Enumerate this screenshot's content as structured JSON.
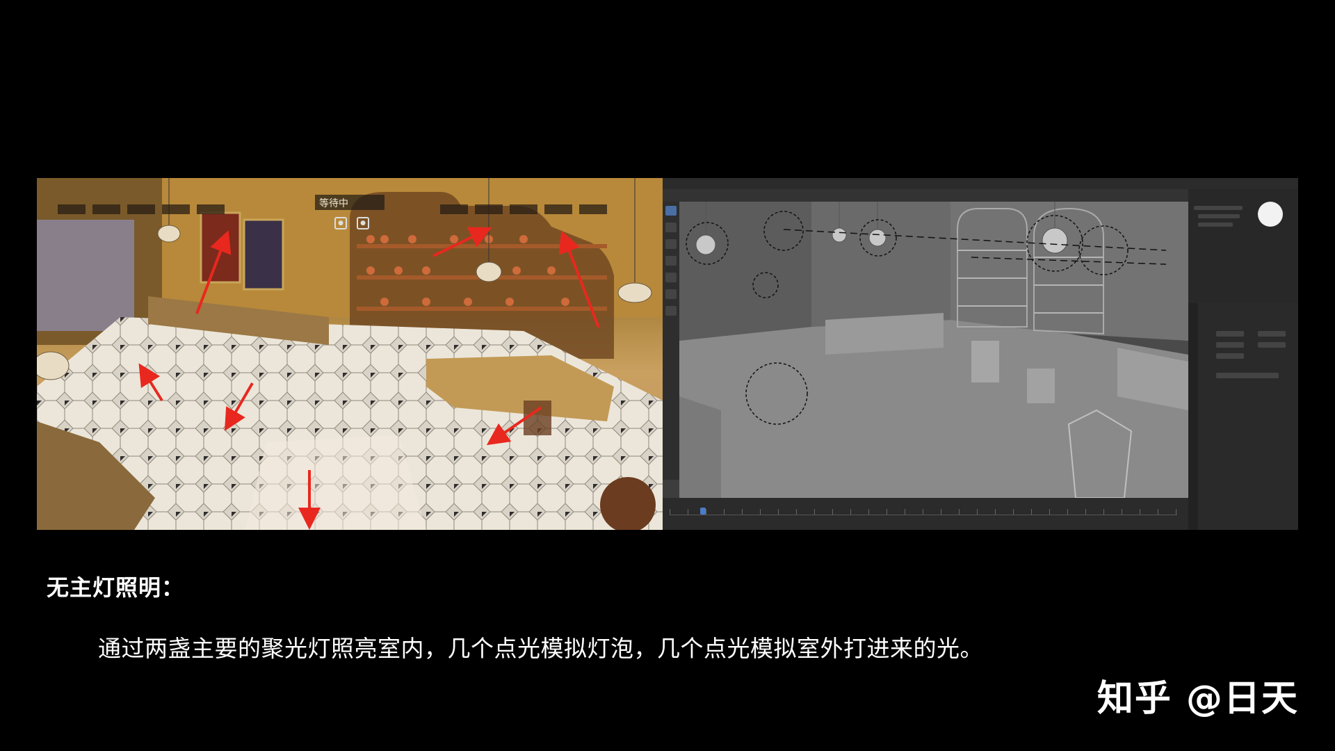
{
  "heading": "无主灯照明：",
  "caption": "通过两盏主要的聚光灯照亮室内，几个点光模拟灯泡，几个点光模拟室外打进来的光。",
  "watermark": "知乎 @日天",
  "game_view": {
    "status_label": "等待中",
    "icons": [
      "lock-icon",
      "lock-icon"
    ]
  },
  "colors": {
    "arrow": "#e8281e",
    "background": "#000000",
    "viewport": "#3d3d3d"
  }
}
